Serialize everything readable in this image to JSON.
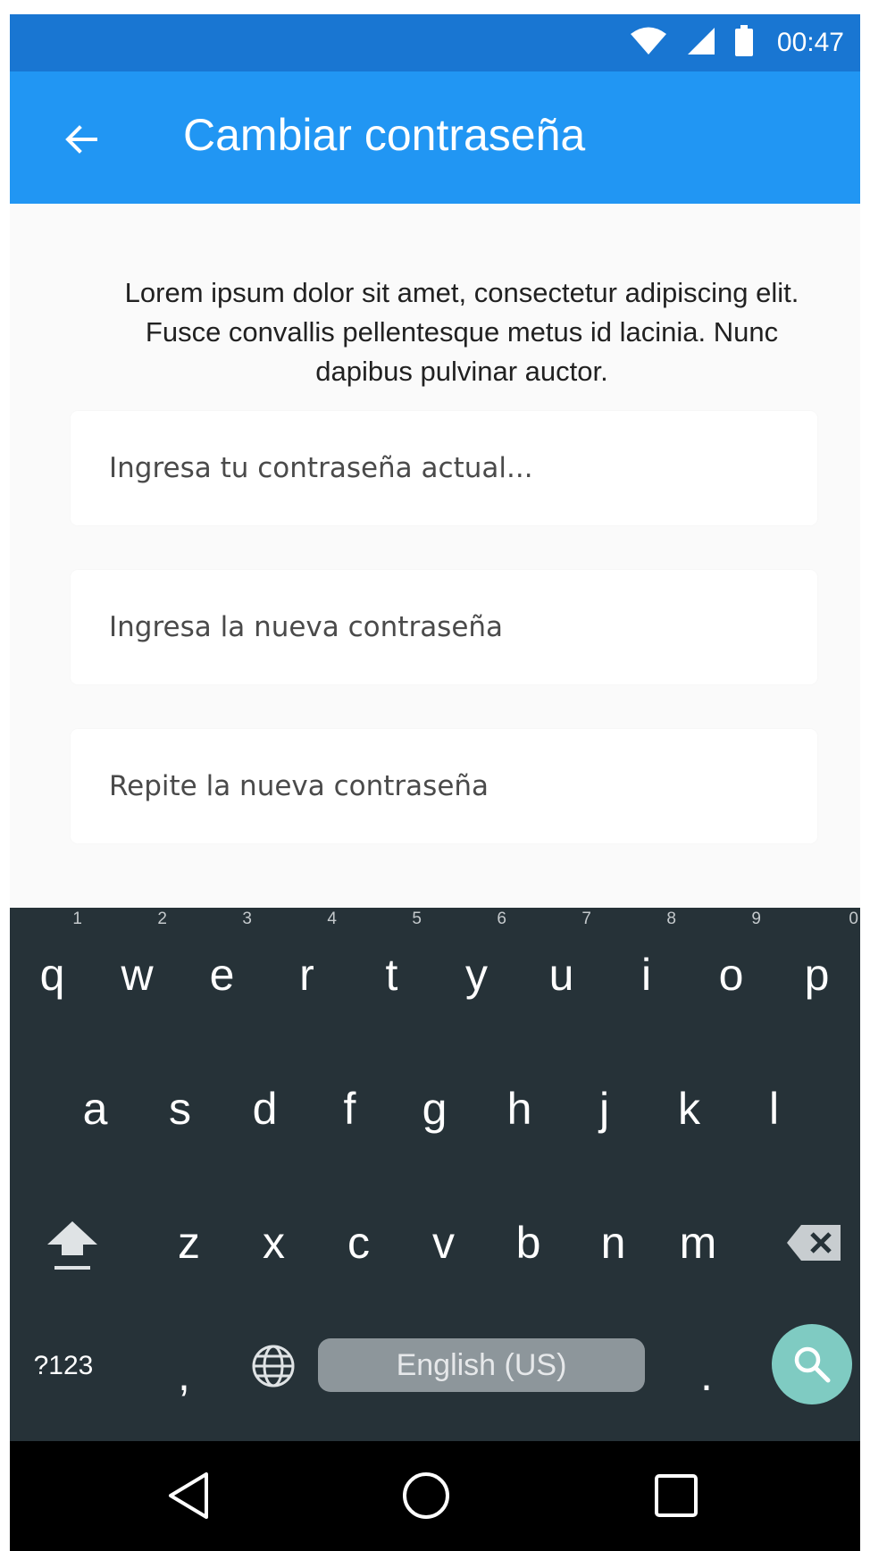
{
  "status_bar": {
    "time": "00:47",
    "icons": [
      "wifi-icon",
      "signal-icon",
      "battery-icon"
    ]
  },
  "app_bar": {
    "title": "Cambiar contraseña",
    "back_icon": "arrow-left-icon"
  },
  "content": {
    "description": "Lorem ipsum dolor sit amet, consectetur adipiscing elit. Fusce convallis pellentesque metus id lacinia. Nunc dapibus pulvinar auctor.",
    "fields": [
      {
        "placeholder": "Ingresa tu contraseña actual...",
        "value": ""
      },
      {
        "placeholder": "Ingresa la nueva contraseña",
        "value": ""
      },
      {
        "placeholder": "Repite la nueva contraseña",
        "value": ""
      }
    ]
  },
  "keyboard": {
    "row1": [
      "q",
      "w",
      "e",
      "r",
      "t",
      "y",
      "u",
      "i",
      "o",
      "p"
    ],
    "row1_numbers": [
      "1",
      "2",
      "3",
      "4",
      "5",
      "6",
      "7",
      "8",
      "9",
      "0"
    ],
    "row2": [
      "a",
      "s",
      "d",
      "f",
      "g",
      "h",
      "j",
      "k",
      "l"
    ],
    "row3": [
      "z",
      "x",
      "c",
      "v",
      "b",
      "n",
      "m"
    ],
    "symbols_label": "?123",
    "comma": ",",
    "period": ".",
    "space_label": "English (US)",
    "icons": [
      "shift-icon",
      "backspace-icon",
      "globe-icon",
      "search-icon"
    ]
  },
  "nav_bar": {
    "icons": [
      "back-triangle-icon",
      "home-circle-icon",
      "recents-square-icon"
    ]
  },
  "colors": {
    "status_bar": "#1976d2",
    "app_bar": "#2196f3",
    "keyboard_bg": "#263238",
    "search_key": "#7fcbc2"
  }
}
